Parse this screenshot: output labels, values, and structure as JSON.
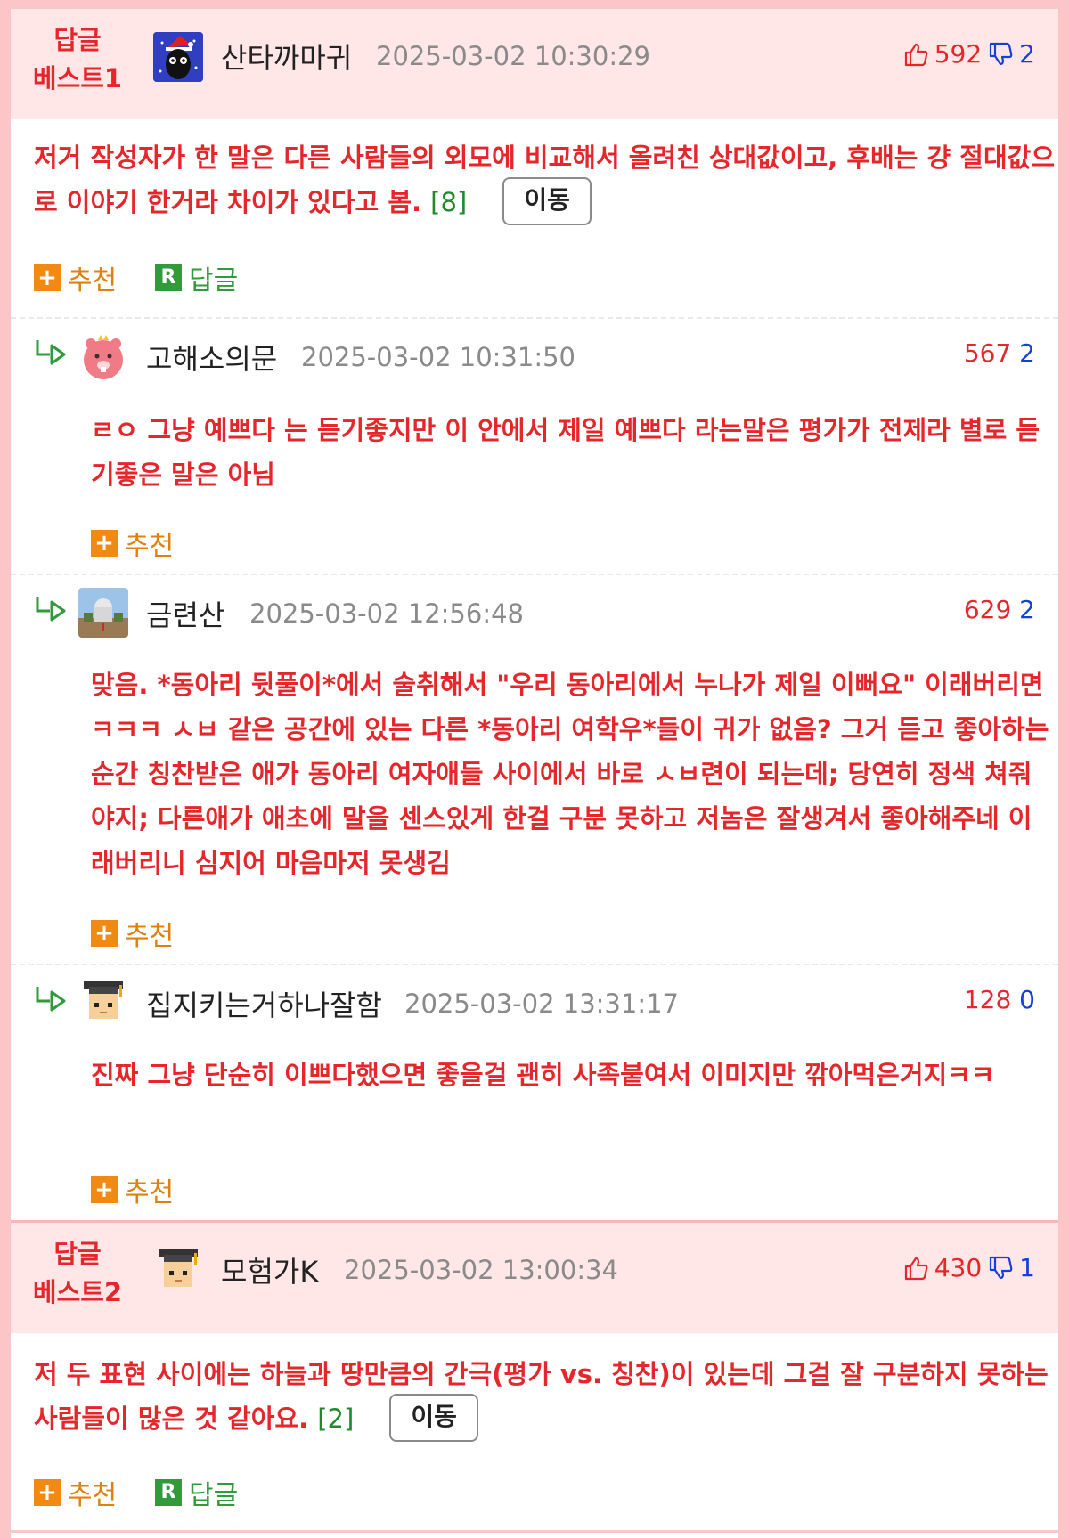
{
  "colors": {
    "accent_red": "#e5272b",
    "down_blue": "#1440d6",
    "orange": "#e0800f",
    "green": "#2f9b3a",
    "best_bg": "#ffe7e8"
  },
  "best1": {
    "label_line1": "답글",
    "label_line2": "베스트1",
    "nick": "산타까마귀",
    "date": "2025-03-02 10:30:29",
    "up": "592",
    "down": "2",
    "text": "저거 작성자가 한 말은 다른 사람들의 외모에 비교해서 올려친 상대값이고, 후배는 걍 절대값으로 이야기 한거라 차이가 있다고 봄.",
    "reply_count": "[8]",
    "move_label": "이동",
    "recommend_label": "추천",
    "reply_label": "답글"
  },
  "replies": [
    {
      "nick": "고해소의문",
      "date": "2025-03-02 10:31:50",
      "up": "567",
      "down": "2",
      "text": "ㄹㅇ 그냥 예쁘다 는 듣기좋지만 이 안에서 제일 예쁘다 라는말은 평가가 전제라 별로 듣기좋은 말은 아님",
      "recommend_label": "추천"
    },
    {
      "nick": "금련산",
      "date": "2025-03-02 12:56:48",
      "up": "629",
      "down": "2",
      "text": "맞음. *동아리 뒷풀이*에서 술취해서 \"우리 동아리에서 누나가 제일 이뻐요\" 이래버리면 ㅋㅋㅋ ㅅㅂ 같은 공간에 있는 다른 *동아리 여학우*들이 귀가 없음? 그거 듣고 좋아하는 순간 칭찬받은 애가 동아리 여자애들 사이에서 바로 ㅅㅂ련이 되는데; 당연히 정색 쳐줘야지; 다른애가 애초에 말을 센스있게 한걸 구분 못하고 저놈은 잘생겨서 좋아해주네 이래버리니 심지어 마음마저 못생김",
      "recommend_label": "추천"
    },
    {
      "nick": "집지키는거하나잘함",
      "date": "2025-03-02 13:31:17",
      "up": "128",
      "down": "0",
      "text": "진짜 그냥 단순히 이쁘다했으면 좋을걸 괜히 사족붙여서 이미지만 깎아먹은거지ㅋㅋ",
      "recommend_label": "추천"
    }
  ],
  "best2": {
    "label_line1": "답글",
    "label_line2": "베스트2",
    "nick": "모험가K",
    "date": "2025-03-02 13:00:34",
    "up": "430",
    "down": "1",
    "text": "저 두 표현 사이에는 하늘과 땅만큼의 간극(평가 vs. 칭찬)이 있는데 그걸 잘 구분하지 못하는 사람들이 많은 것 같아요.",
    "reply_count": "[2]",
    "move_label": "이동",
    "recommend_label": "추천",
    "reply_label": "답글"
  }
}
